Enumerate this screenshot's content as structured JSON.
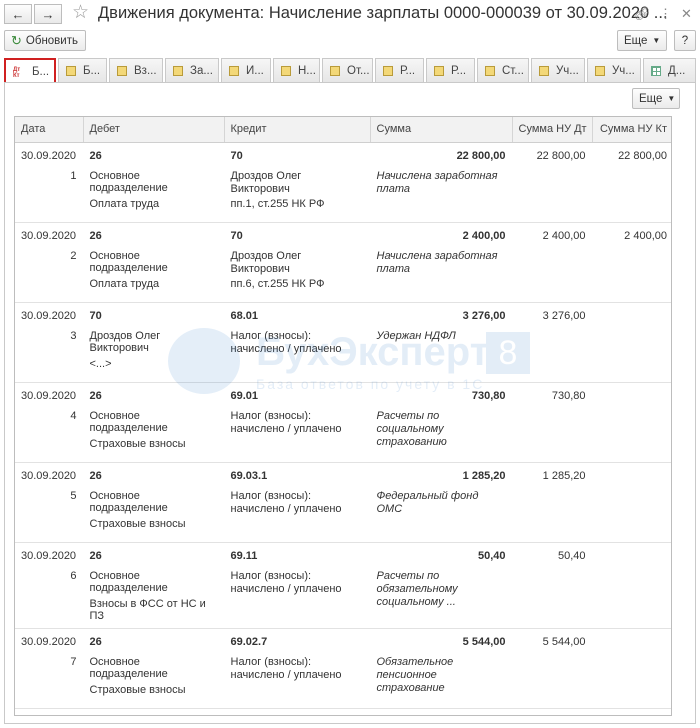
{
  "window": {
    "title": "Движения документа: Начисление зарплаты 0000-000039 от 30.09.2020 ...",
    "back_icon": "arrow-left-icon",
    "forward_icon": "arrow-right-icon",
    "favorite_icon": "star-icon"
  },
  "toolbar": {
    "refresh_label": "Обновить",
    "more_label": "Еще",
    "help_label": "?"
  },
  "tabs": [
    {
      "label": "Б...",
      "icon": "dt-kt-icon",
      "active": true
    },
    {
      "label": "Б...",
      "icon": "register-icon"
    },
    {
      "label": "Вз...",
      "icon": "register-icon"
    },
    {
      "label": "За...",
      "icon": "register-icon"
    },
    {
      "label": "И...",
      "icon": "register-icon"
    },
    {
      "label": "Н...",
      "icon": "register-icon"
    },
    {
      "label": "От...",
      "icon": "register-icon"
    },
    {
      "label": "Р...",
      "icon": "register-icon"
    },
    {
      "label": "Р...",
      "icon": "register-icon"
    },
    {
      "label": "Ст...",
      "icon": "register-icon"
    },
    {
      "label": "Уч...",
      "icon": "register-icon"
    },
    {
      "label": "Уч...",
      "icon": "register-icon"
    },
    {
      "label": "Д...",
      "icon": "grid-icon"
    }
  ],
  "panel": {
    "more_label": "Еще"
  },
  "table": {
    "columns": [
      "Дата",
      "Дебет",
      "Кредит",
      "Сумма",
      "Сумма НУ Дт",
      "Сумма НУ Кт"
    ],
    "rows": [
      {
        "date": "30.09.2020",
        "num": "1",
        "debit_account": "26",
        "debit_sub1": "Основное подразделение",
        "debit_sub2": "Оплата труда",
        "credit_account": "70",
        "credit_sub1": "Дроздов Олег Викторович",
        "credit_sub2": "пп.1, ст.255 НК РФ",
        "sum": "22 800,00",
        "content": "Начислена заработная плата",
        "nu_dt": "22 800,00",
        "nu_kt": "22 800,00"
      },
      {
        "date": "30.09.2020",
        "num": "2",
        "debit_account": "26",
        "debit_sub1": "Основное подразделение",
        "debit_sub2": "Оплата труда",
        "credit_account": "70",
        "credit_sub1": "Дроздов Олег Викторович",
        "credit_sub2": "пп.6, ст.255 НК РФ",
        "sum": "2 400,00",
        "content": "Начислена заработная плата",
        "nu_dt": "2 400,00",
        "nu_kt": "2 400,00"
      },
      {
        "date": "30.09.2020",
        "num": "3",
        "debit_account": "70",
        "debit_sub1": "Дроздов Олег Викторович",
        "debit_sub2": "<...>",
        "credit_account": "68.01",
        "credit_sub1": "Налог (взносы): начислено / уплачено",
        "credit_sub2": "",
        "sum": "3 276,00",
        "content": "Удержан НДФЛ",
        "nu_dt": "3 276,00",
        "nu_kt": ""
      },
      {
        "date": "30.09.2020",
        "num": "4",
        "debit_account": "26",
        "debit_sub1": "Основное подразделение",
        "debit_sub2": "Страховые взносы",
        "credit_account": "69.01",
        "credit_sub1": "Налог (взносы): начислено / уплачено",
        "credit_sub2": "",
        "sum": "730,80",
        "content": "Расчеты по социальному страхованию",
        "nu_dt": "730,80",
        "nu_kt": ""
      },
      {
        "date": "30.09.2020",
        "num": "5",
        "debit_account": "26",
        "debit_sub1": "Основное подразделение",
        "debit_sub2": "Страховые взносы",
        "credit_account": "69.03.1",
        "credit_sub1": "Налог (взносы): начислено / уплачено",
        "credit_sub2": "",
        "sum": "1 285,20",
        "content": "Федеральный фонд ОМС",
        "nu_dt": "1 285,20",
        "nu_kt": ""
      },
      {
        "date": "30.09.2020",
        "num": "6",
        "debit_account": "26",
        "debit_sub1": "Основное подразделение",
        "debit_sub2": "Взносы в ФСС от НС и ПЗ",
        "credit_account": "69.11",
        "credit_sub1": "Налог (взносы): начислено / уплачено",
        "credit_sub2": "",
        "sum": "50,40",
        "content": "Расчеты по обязательному социальному ...",
        "nu_dt": "50,40",
        "nu_kt": ""
      },
      {
        "date": "30.09.2020",
        "num": "7",
        "debit_account": "26",
        "debit_sub1": "Основное подразделение",
        "debit_sub2": "Страховые взносы",
        "credit_account": "69.02.7",
        "credit_sub1": "Налог (взносы): начислено / уплачено",
        "credit_sub2": "",
        "sum": "5 544,00",
        "content": "Обязательное пенсионное страхование",
        "nu_dt": "5 544,00",
        "nu_kt": ""
      }
    ]
  },
  "watermark": {
    "brand": "БухЭксперт",
    "number": "8",
    "tagline": "База ответов по учету в 1С"
  }
}
